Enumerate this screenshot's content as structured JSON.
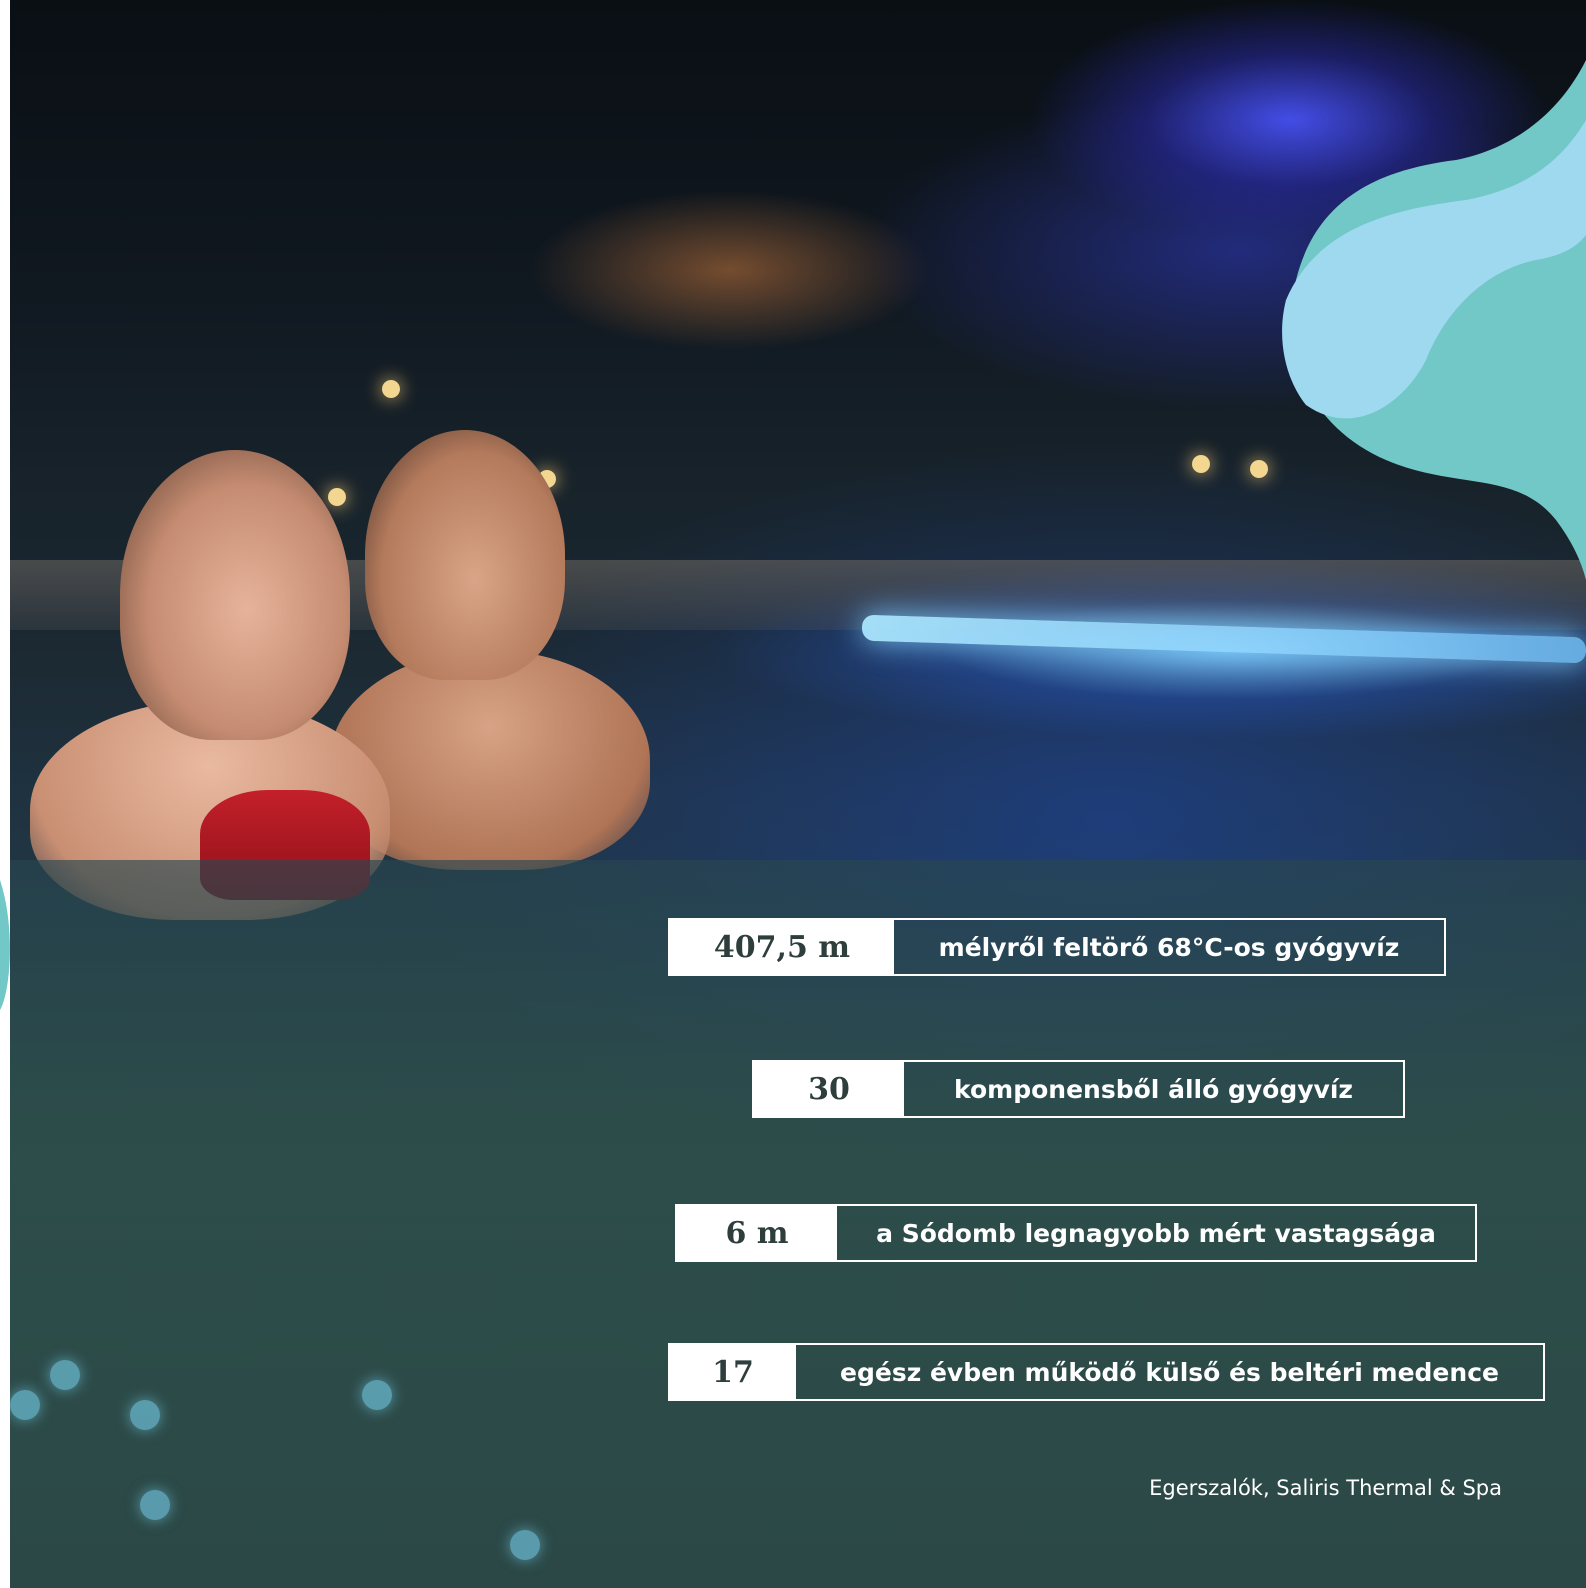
{
  "colors": {
    "wave_dark": "#72c7c7",
    "wave_light": "#9ed9f0",
    "stat_value_text": "#2d3e3c",
    "stat_border": "#ffffff"
  },
  "stats": [
    {
      "value": "407,5 m",
      "description": "mélyről feltörő 68°C-os gyógyvíz"
    },
    {
      "value": "30",
      "description": "komponensből álló gyógyvíz"
    },
    {
      "value": "6 m",
      "description": "a Sódomb legnagyobb mért vastagsága"
    },
    {
      "value": "17",
      "description": "egész évben működő külső és beltéri medence"
    }
  ],
  "caption": "Egerszalók, Saliris Thermal & Spa"
}
